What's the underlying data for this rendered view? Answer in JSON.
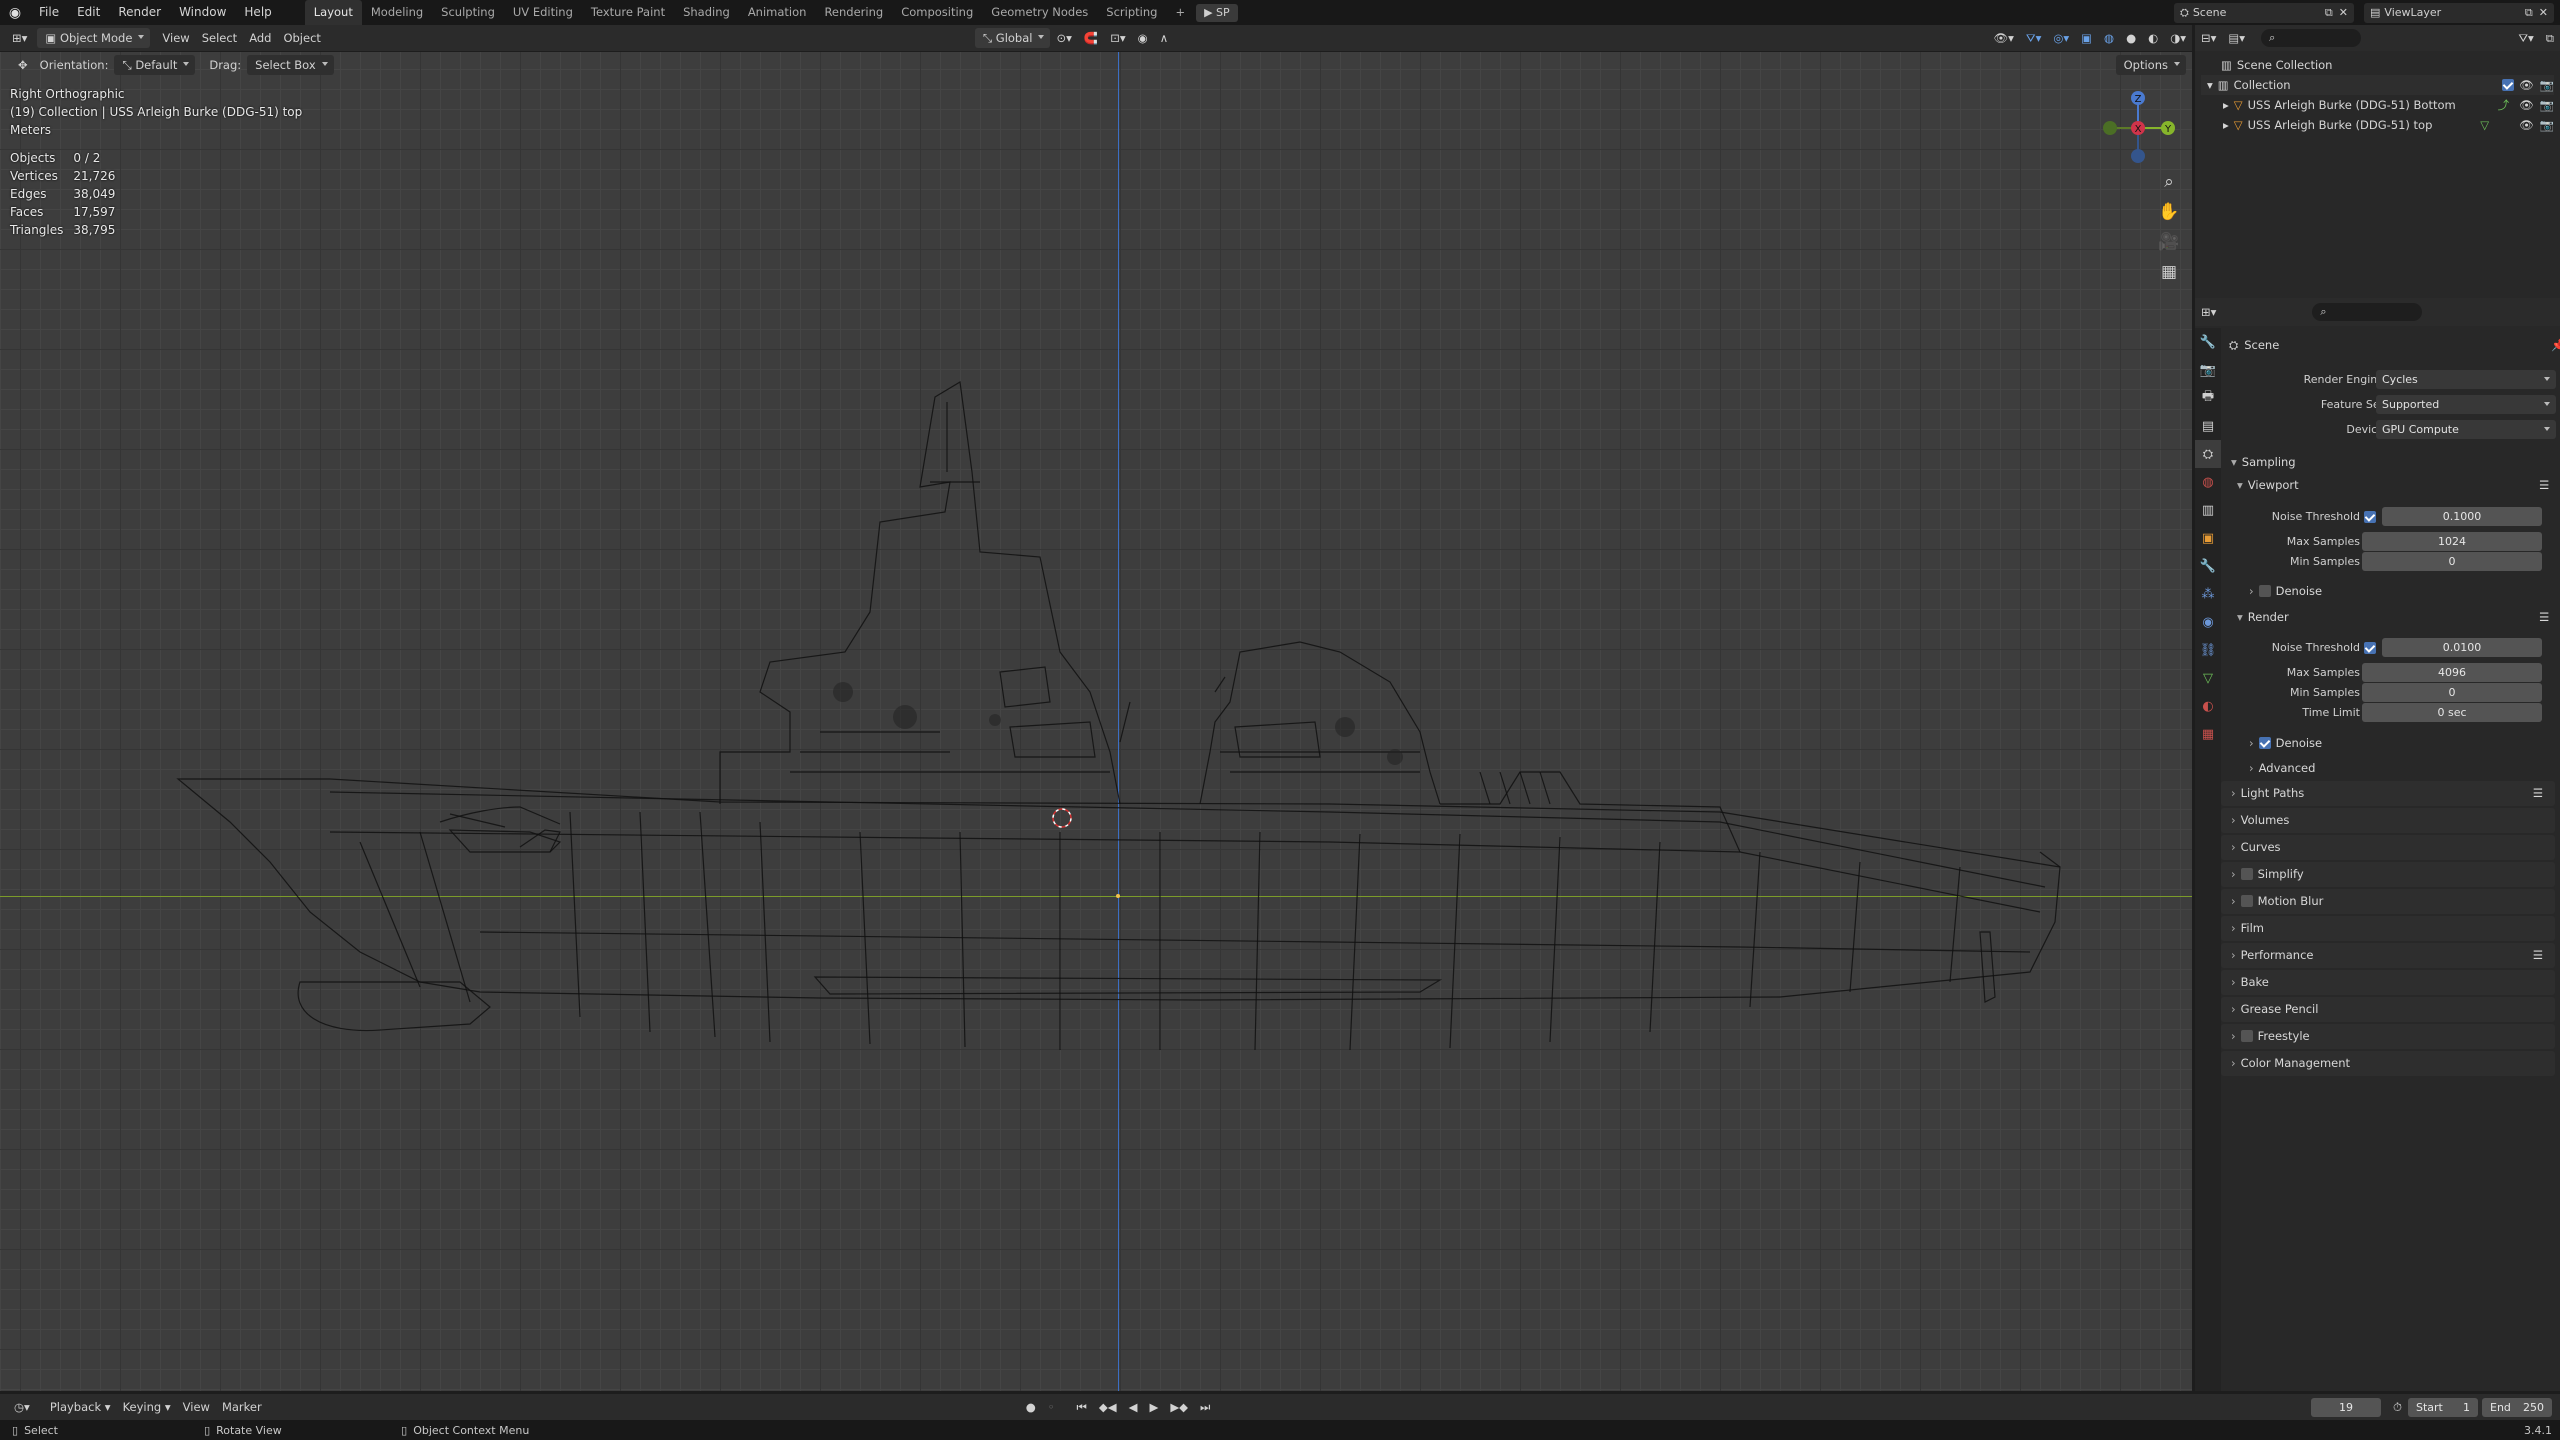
{
  "menu": {
    "items": [
      "File",
      "Edit",
      "Render",
      "Window",
      "Help"
    ]
  },
  "workspaces": {
    "active": "Layout",
    "tabs": [
      "Modeling",
      "Sculpting",
      "UV Editing",
      "Texture Paint",
      "Shading",
      "Animation",
      "Rendering",
      "Compositing",
      "Geometry Nodes",
      "Scripting"
    ],
    "play_label": "SP"
  },
  "scene_selector": {
    "label": "Scene"
  },
  "viewlayer_selector": {
    "label": "ViewLayer"
  },
  "viewport_header": {
    "mode": "Object Mode",
    "menus": [
      "View",
      "Select",
      "Add",
      "Object"
    ],
    "transform": "Global"
  },
  "tool_header": {
    "orientation_label": "Orientation:",
    "orientation_value": "Default",
    "drag_label": "Drag:",
    "drag_value": "Select Box",
    "options_label": "Options"
  },
  "viewport_info": {
    "view": "Right Orthographic",
    "collection": "(19) Collection | USS Arleigh Burke (DDG-51) top",
    "units": "Meters"
  },
  "stats": [
    {
      "label": "Objects",
      "value": "0 / 2"
    },
    {
      "label": "Vertices",
      "value": "21,726"
    },
    {
      "label": "Edges",
      "value": "38,049"
    },
    {
      "label": "Faces",
      "value": "17,597"
    },
    {
      "label": "Triangles",
      "value": "38,795"
    }
  ],
  "gizmo": {
    "z": "Z",
    "y": "Y",
    "x": "X"
  },
  "outliner": {
    "scene_collection": "Scene Collection",
    "collection": "Collection",
    "objects": [
      "USS Arleigh Burke (DDG-51) Bottom",
      "USS Arleigh Burke (DDG-51) top"
    ]
  },
  "properties": {
    "context": "Scene",
    "render_engine": {
      "label": "Render Engine",
      "value": "Cycles"
    },
    "feature_set": {
      "label": "Feature Set",
      "value": "Supported"
    },
    "device": {
      "label": "Device",
      "value": "GPU Compute"
    },
    "sampling": "Sampling",
    "viewport": {
      "title": "Viewport",
      "noise_threshold_label": "Noise Threshold",
      "noise_threshold": "0.1000",
      "max_samples_label": "Max Samples",
      "max_samples": "1024",
      "min_samples_label": "Min Samples",
      "min_samples": "0",
      "denoise": "Denoise"
    },
    "render": {
      "title": "Render",
      "noise_threshold_label": "Noise Threshold",
      "noise_threshold": "0.0100",
      "max_samples_label": "Max Samples",
      "max_samples": "4096",
      "min_samples_label": "Min Samples",
      "min_samples": "0",
      "time_limit_label": "Time Limit",
      "time_limit": "0 sec",
      "denoise": "Denoise",
      "advanced": "Advanced"
    },
    "panels": [
      "Light Paths",
      "Volumes",
      "Curves",
      "Simplify",
      "Motion Blur",
      "Film",
      "Performance",
      "Bake",
      "Grease Pencil",
      "Freestyle",
      "Color Management"
    ]
  },
  "timeline": {
    "menus": [
      "Playback",
      "Keying",
      "View",
      "Marker"
    ],
    "current_frame": "19",
    "start_label": "Start",
    "start": "1",
    "end_label": "End",
    "end": "250"
  },
  "statusbar": {
    "select": "Select",
    "rotate": "Rotate View",
    "context_menu": "Object Context Menu",
    "version": "3.4.1"
  }
}
